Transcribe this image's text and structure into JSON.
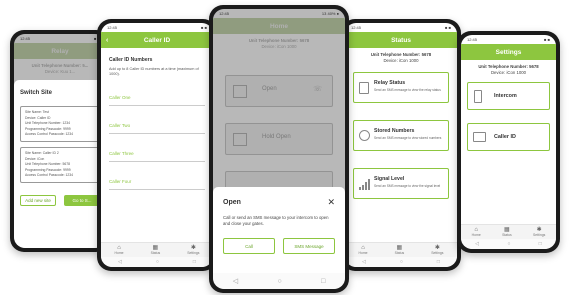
{
  "colors": {
    "accent": "#8dc63f",
    "text": "#333333",
    "phone": "#1b1b1b"
  },
  "phone1": {
    "header_title": "Relay",
    "unit_number": "Unit Telephone Number: 5...",
    "device": "Device: Kuu 1...",
    "sheet_title": "Switch Site",
    "sites": [
      {
        "name": "Site Name: Test",
        "device": "Device: Caller ID",
        "unit": "Unit Telephone Number: 1234",
        "prog": "Programming Passcode: 9999",
        "access": "Access Control Passcode: 1234"
      },
      {
        "name": "Site Name: Caller ID 2",
        "device": "Device: iCon",
        "unit": "Unit Telephone Number: 5678",
        "prog": "Programming Passcode: 9999",
        "access": "Access Control Passcode: 1234"
      }
    ],
    "add_btn": "Add new site",
    "go_btn": "Go to S..."
  },
  "phone2": {
    "header_title": "Caller ID",
    "back_icon": "chevron-left-icon",
    "section_title": "Caller ID Numbers",
    "desc": "Add up to 8 Caller ID numbers at a time (maximum of 1000).",
    "fields": [
      "Caller One",
      "Caller Two",
      "Caller Three",
      "Caller Four"
    ],
    "nav": [
      "Home",
      "Status",
      "Settings"
    ]
  },
  "phone3": {
    "status_time": "12:45",
    "status_right": "13 40% ●",
    "header_title": "Home",
    "unit_number": "Unit Telephone Number: 5678",
    "device": "Device: iCon 1000",
    "buttons": [
      "Open",
      "Hold Open"
    ],
    "sheet_title": "Open",
    "close_icon": "close-icon",
    "sheet_text": "Call or send an SMS message to your intercom to open and close your gates.",
    "call_btn": "Call",
    "sms_btn": "SMS Message"
  },
  "phone4": {
    "header_title": "Status",
    "unit_number": "Unit Telephone Number: 5678",
    "device": "Device: iCon 1000",
    "cards": [
      {
        "title": "Relay Status",
        "desc": "Send an SMS message to view the relay status"
      },
      {
        "title": "Stored Numbers",
        "desc": "Send an SMS message to view stored numbers"
      },
      {
        "title": "Signal Level",
        "desc": "Send an SMS message to view the signal level"
      }
    ],
    "nav": [
      "Home",
      "Status",
      "Settings"
    ]
  },
  "phone5": {
    "header_title": "Settings",
    "unit_number": "Unit Telephone Number: 5678",
    "device": "Device: iCon 1000",
    "cards": [
      "Intercom",
      "Caller ID"
    ],
    "nav": [
      "Home",
      "Status",
      "Settings"
    ]
  }
}
